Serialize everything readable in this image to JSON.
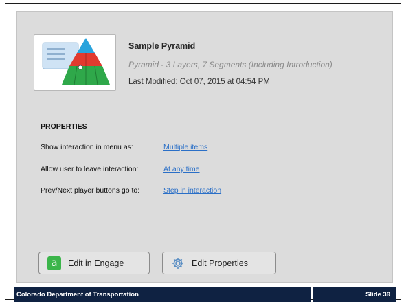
{
  "item": {
    "title": "Sample Pyramid",
    "subtitle": "Pyramid - 3 Layers, 7 Segments (Including Introduction)",
    "last_modified": "Last Modified: Oct 07, 2015 at 04:54 PM",
    "thumbnail_icon": "pyramid-thumbnail-icon"
  },
  "properties": {
    "heading": "PROPERTIES",
    "rows": [
      {
        "label": "Show interaction in menu as:",
        "value": "Multiple items"
      },
      {
        "label": "Allow user to leave interaction:",
        "value": "At any time"
      },
      {
        "label": "Prev/Next player buttons go to:",
        "value": "Step in interaction"
      }
    ]
  },
  "buttons": {
    "edit_engage": {
      "label": "Edit in Engage",
      "icon": "engage-a-icon",
      "icon_text": "a"
    },
    "edit_properties": {
      "label": "Edit Properties",
      "icon": "gear-icon"
    }
  },
  "footer": {
    "organization": "Colorado Department of Transportation",
    "slide": "Slide 39"
  },
  "colors": {
    "panel": "#dcdcdc",
    "link": "#2a6fc7",
    "footer": "#0f2242",
    "engage_green": "#3bb54a"
  }
}
